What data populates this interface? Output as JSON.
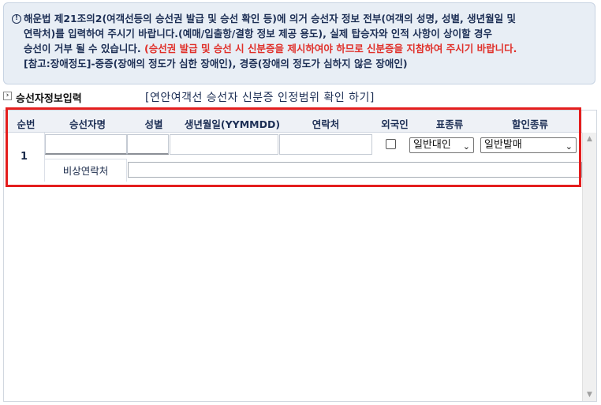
{
  "notice": {
    "icon": "exclamation-circle-icon",
    "line1": "해운법 제21조의2(여객선등의 승선권 발급 및 승선 확인 등)에 의거 승선자 정보 전부(여객의 성명, 성별, 생년월일 및",
    "line2": "연락처)를 입력하여 주시기 바랍니다.(예매/입출항/결항 정보 제공 용도), 실제 탑승자와 인적 사항이 상이할 경우",
    "line3_normal": "승선이 거부 될 수 있습니다.",
    "line3_red": "(승선권 발급 및 승선 시 신분증을 제시하여야 하므로 신분증을 지참하여 주시기 바랍니다.",
    "line4": "[참고:장애정도]-중증(장애의 정도가 심한 장애인), 경증(장애의 정도가 심하지 않은 장애인)"
  },
  "section": {
    "arrow_icon": "chevron-right-icon",
    "title": "승선자정보입력",
    "link": "[연안여객선 승선자 신분증 인정범위 확인 하기]"
  },
  "table": {
    "headers": [
      "순번",
      "승선자명",
      "성별",
      "생년월일(YYMMDD)",
      "연락처",
      "외국인",
      "표종류",
      "할인종류"
    ],
    "row": {
      "seq": "1",
      "name_value": "",
      "gender_value": "",
      "birth_value": "",
      "phone_value": "",
      "foreigner_checked": false,
      "ticket_type": "일반대인",
      "discount_type": "일반발매",
      "emergency_label": "비상연락처",
      "emergency_value": ""
    }
  },
  "colors": {
    "highlight": "#e41e1e",
    "notice_bg": "#e8eef5",
    "red_text": "#e0302a",
    "header_bg": "#eef1f6"
  }
}
